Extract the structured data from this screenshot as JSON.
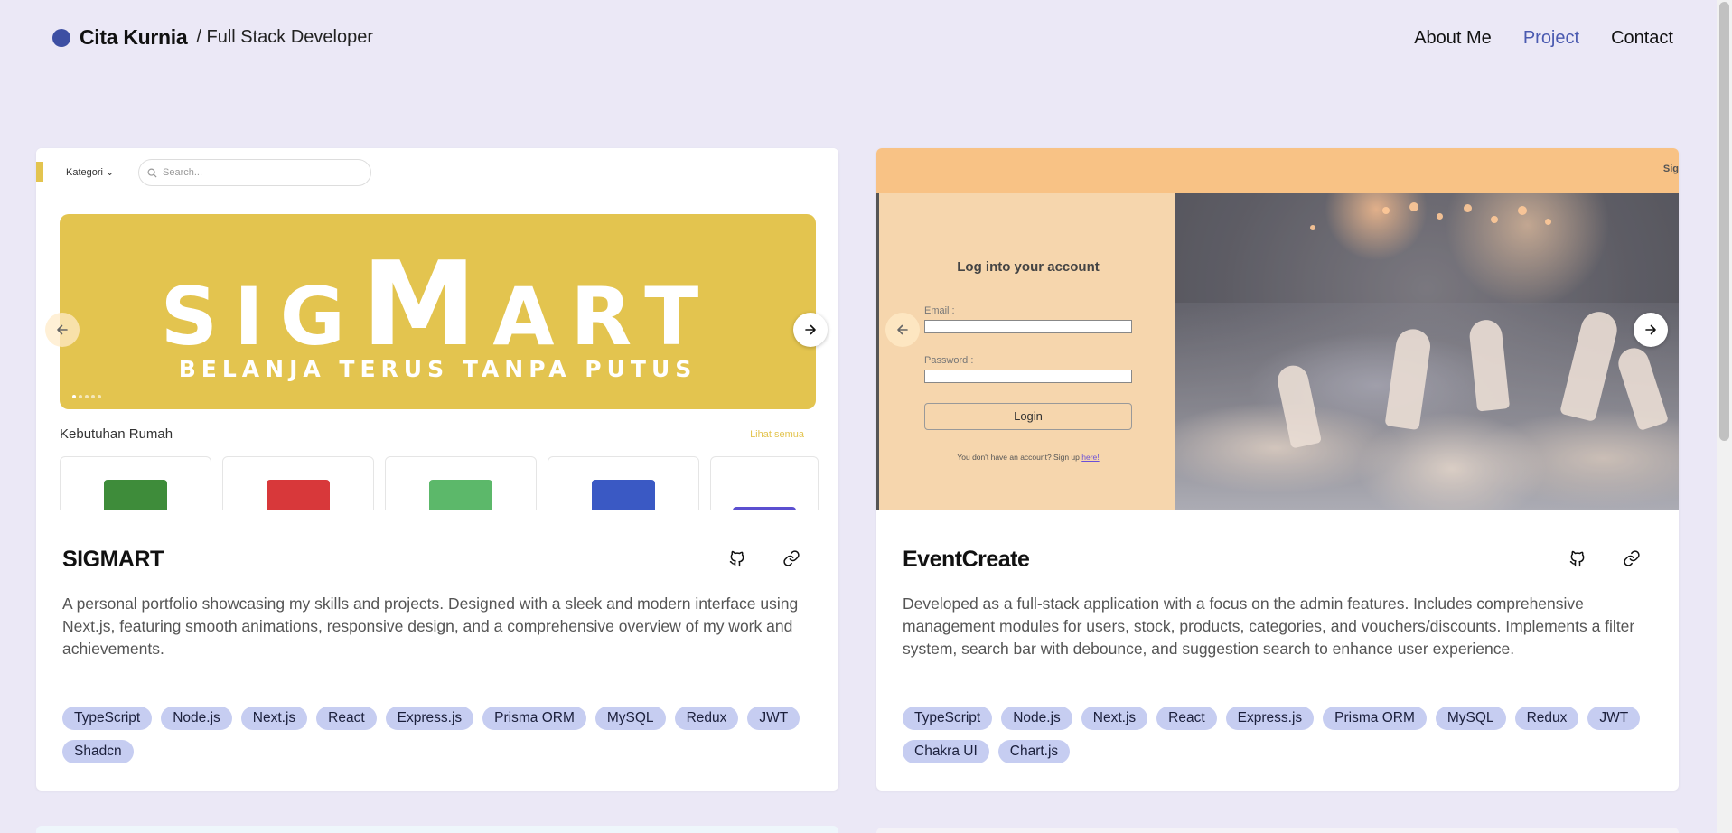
{
  "header": {
    "name": "Cita Kurnia",
    "role": "/ Full Stack Developer",
    "nav": [
      {
        "label": "About Me",
        "active": false
      },
      {
        "label": "Project",
        "active": true
      },
      {
        "label": "Contact",
        "active": false
      }
    ]
  },
  "colors": {
    "background": "#ebe8f6",
    "accent": "#4a5ab0",
    "tag_bg": "#c6cdf1",
    "sigmart_yellow": "#e3c44f",
    "event_orange": "#f8c285"
  },
  "projects": [
    {
      "title": "SIGMART",
      "description": "A personal portfolio showcasing my skills and projects. Designed with a sleek and modern interface using Next.js, featuring smooth animations, responsive design, and a comprehensive overview of my work and achievements.",
      "tags": [
        "TypeScript",
        "Node.js",
        "Next.js",
        "React",
        "Express.js",
        "Prisma ORM",
        "MySQL",
        "Redux",
        "JWT",
        "Shadcn"
      ],
      "preview": {
        "category_label": "Kategori",
        "search_placeholder": "Search...",
        "banner_logo": "SIGMART",
        "banner_logo_parts": [
          "SIG",
          "M",
          "ART"
        ],
        "banner_tagline": "BELANJA TERUS TANPA PUTUS",
        "section_title": "Kebutuhan Rumah",
        "section_link": "Lihat semua"
      },
      "icons": [
        "github-icon",
        "link-icon"
      ]
    },
    {
      "title": "EventCreate",
      "description": "Developed as a full-stack application with a focus on the admin features. Includes comprehensive management modules for users, stock, products, categories, and vouchers/discounts. Implements a filter system, search bar with debounce, and suggestion search to enhance user experience.",
      "tags": [
        "TypeScript",
        "Node.js",
        "Next.js",
        "React",
        "Express.js",
        "Prisma ORM",
        "MySQL",
        "Redux",
        "JWT",
        "Chakra UI",
        "Chart.js"
      ],
      "preview": {
        "topbar_text": "Sig",
        "login_title": "Log into your account",
        "email_label": "Email :",
        "password_label": "Password :",
        "login_button": "Login",
        "signup_text": "You don't have an account? Sign up ",
        "signup_link": "here!"
      },
      "icons": [
        "github-icon",
        "link-icon"
      ]
    }
  ]
}
